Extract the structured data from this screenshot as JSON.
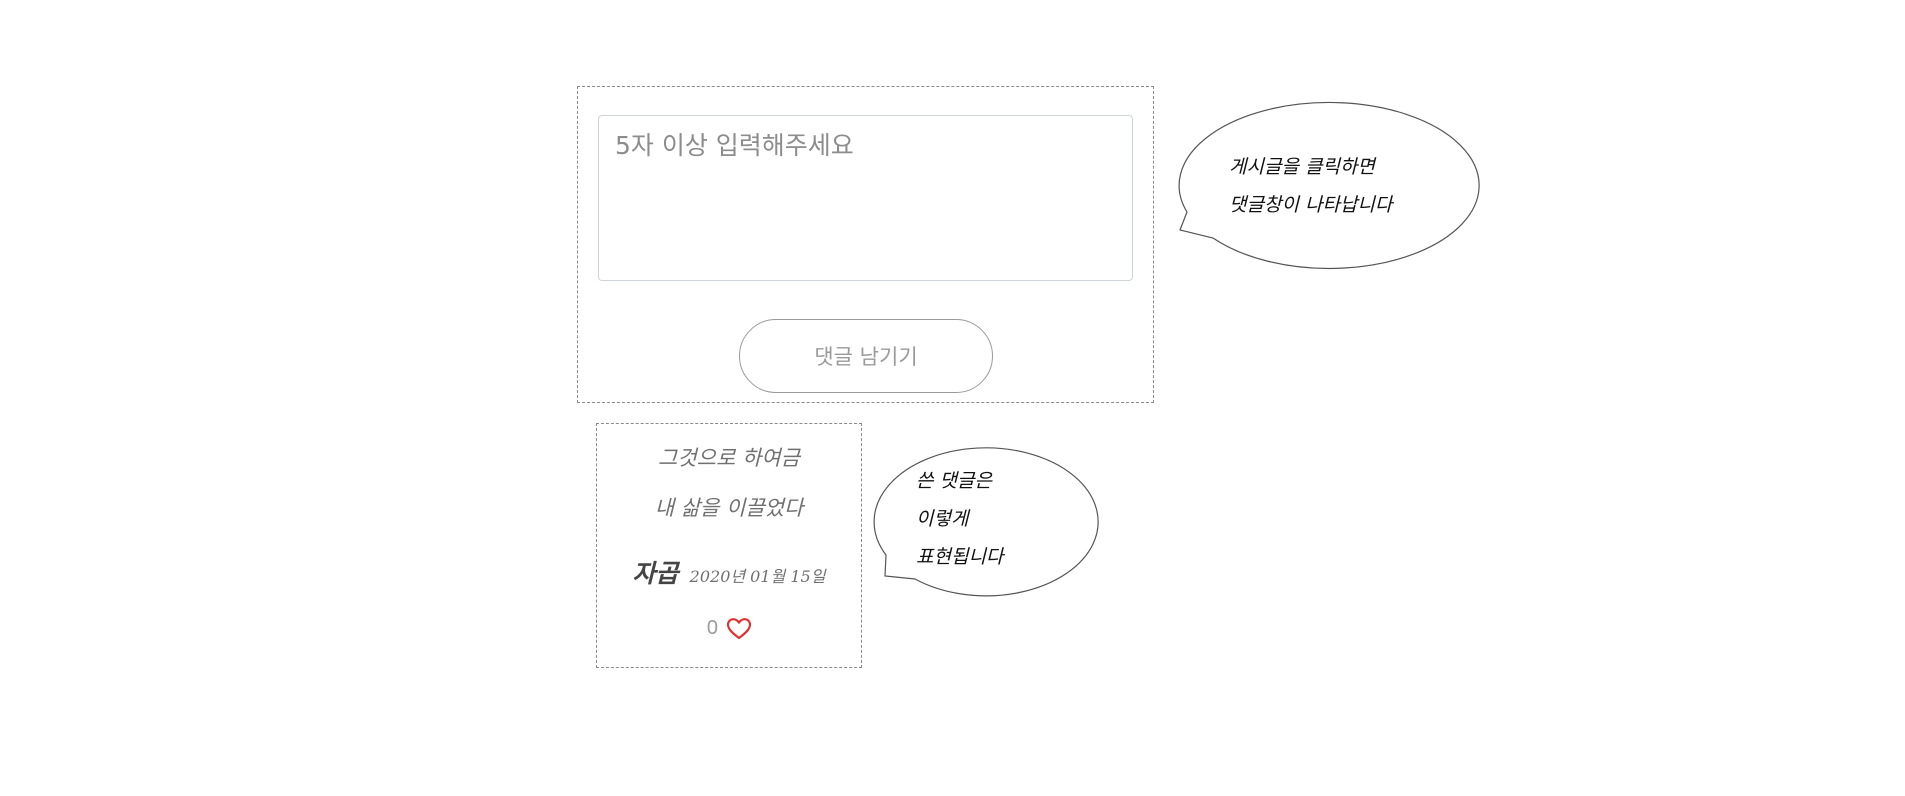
{
  "comment_form": {
    "input_placeholder": "5자 이상 입력해주세요",
    "input_value": "",
    "submit_label": "댓글 남기기"
  },
  "comment_card": {
    "lines": [
      "그것으로 하여금",
      "내 삶을 이끌었다"
    ],
    "author": "자곱",
    "date": "2020년 01월 15일",
    "like_count": "0",
    "like_icon": "heart-outline-icon",
    "like_color": "#e03131"
  },
  "tooltips": {
    "post_click_hint": [
      "게시글을 클릭하면",
      "댓글창이 나타납니다"
    ],
    "comment_display_hint": [
      "쓴 댓글은",
      "이렇게",
      "표현됩니다"
    ]
  }
}
